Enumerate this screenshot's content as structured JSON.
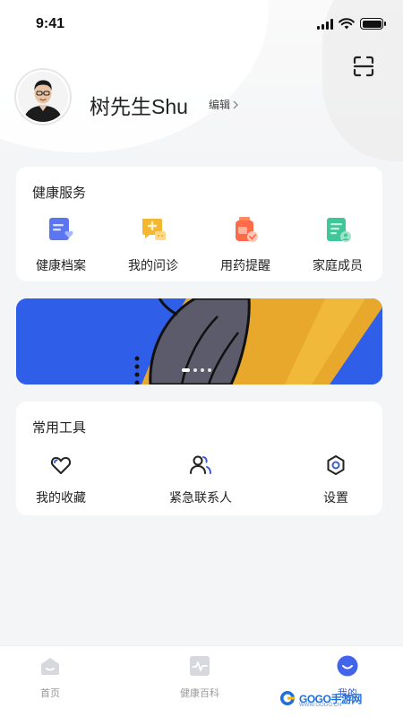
{
  "status_bar": {
    "time": "9:41"
  },
  "profile": {
    "name": "树先生Shu",
    "edit_label": "编辑"
  },
  "health_services": {
    "title": "健康服务",
    "items": [
      {
        "label": "健康档案",
        "icon": "health-record-icon"
      },
      {
        "label": "我的问诊",
        "icon": "consultation-icon"
      },
      {
        "label": "用药提醒",
        "icon": "medication-icon"
      },
      {
        "label": "家庭成员",
        "icon": "family-icon"
      }
    ]
  },
  "banner": {
    "slides": 4,
    "active_index": 0
  },
  "tools": {
    "title": "常用工具",
    "items": [
      {
        "label": "我的收藏",
        "icon": "heart-icon"
      },
      {
        "label": "紧急联系人",
        "icon": "contacts-icon"
      },
      {
        "label": "设置",
        "icon": "settings-icon"
      }
    ]
  },
  "tab_bar": {
    "items": [
      {
        "label": "首页",
        "icon": "home-icon"
      },
      {
        "label": "健康百科",
        "icon": "pulse-icon"
      },
      {
        "label": "我的",
        "icon": "profile-icon",
        "active": true
      }
    ]
  },
  "watermark": {
    "text": "GOGO手游网",
    "sub": "WWW.GOGO.CN"
  },
  "colors": {
    "accent": "#3b5bdb",
    "banner_blue": "#2f5fe8",
    "banner_yellow": "#e8a82c"
  }
}
